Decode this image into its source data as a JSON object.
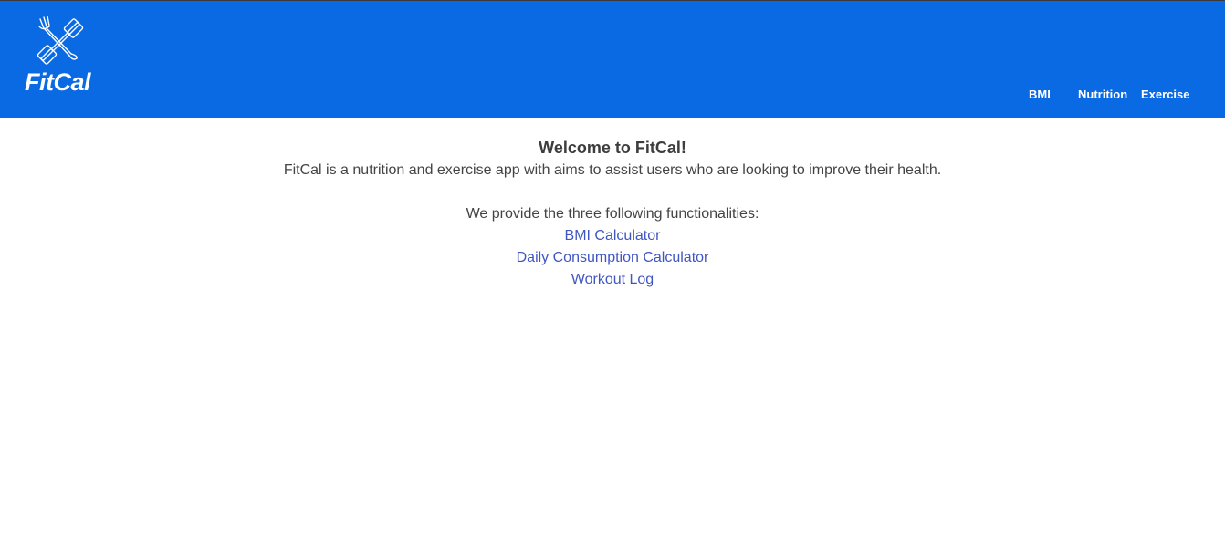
{
  "brand": {
    "name": "FitCal",
    "logo_icon": "fork-knife-dumbbell-icon"
  },
  "nav": {
    "items": [
      {
        "label": "BMI"
      },
      {
        "label": "Nutrition"
      },
      {
        "label": "Exercise"
      }
    ]
  },
  "main": {
    "title": "Welcome to FitCal!",
    "intro": "FitCal is a nutrition and exercise app with aims to assist users who are looking to improve their health.",
    "provide_text": "We provide the three following functionalities:",
    "features": [
      {
        "label": "BMI Calculator"
      },
      {
        "label": "Daily Consumption Calculator"
      },
      {
        "label": "Workout Log"
      }
    ]
  },
  "colors": {
    "header_bg": "#0a6ae4",
    "link": "#4056c2",
    "body_text": "#444444"
  }
}
